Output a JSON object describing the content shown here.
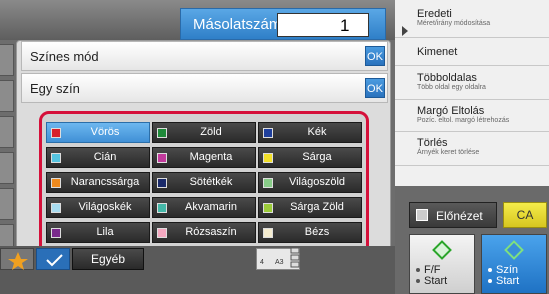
{
  "header": {
    "copies_label": "Másolatszám",
    "copies_value": "1"
  },
  "panel": {
    "rows": [
      {
        "label": "Színes mód",
        "ok": "OK"
      },
      {
        "label": "Egy szín",
        "ok": "OK"
      }
    ],
    "colors": [
      {
        "label": "Vörös",
        "swatch": "#d8202a",
        "selected": true
      },
      {
        "label": "Zöld",
        "swatch": "#1f8a3a"
      },
      {
        "label": "Kék",
        "swatch": "#1f3f9c"
      },
      {
        "label": "Cián",
        "swatch": "#55c4e0"
      },
      {
        "label": "Magenta",
        "swatch": "#c23a9c"
      },
      {
        "label": "Sárga",
        "swatch": "#f2e02a"
      },
      {
        "label": "Narancssárga",
        "swatch": "#ef8a1e"
      },
      {
        "label": "Sötétkék",
        "swatch": "#1a2a6a"
      },
      {
        "label": "Világoszöld",
        "swatch": "#88cc88"
      },
      {
        "label": "Világoskék",
        "swatch": "#a8dcf0"
      },
      {
        "label": "Akvamarin",
        "swatch": "#44b8a8"
      },
      {
        "label": "Sárga Zöld",
        "swatch": "#9ccc3a"
      },
      {
        "label": "Lila",
        "swatch": "#7a2a8c"
      },
      {
        "label": "Rózsaszín",
        "swatch": "#f4a8c0"
      },
      {
        "label": "Bézs",
        "swatch": "#f4ecd0"
      }
    ]
  },
  "sidebar": {
    "items": [
      {
        "title": "Eredeti",
        "sub": "Méret/irány módosítása"
      },
      {
        "title": "Kimenet",
        "sub": ""
      },
      {
        "title": "Többoldalas",
        "sub": "Több oldal egy oldalra"
      },
      {
        "title": "Margó Eltolás",
        "sub": "Pozíc. eltol. margó létrehozás"
      },
      {
        "title": "Törlés",
        "sub": "Árnyék keret törlése"
      }
    ]
  },
  "actions": {
    "preview": "Előnézet",
    "ca": "CA",
    "start_bw_line1": "F/F",
    "start_bw_line2": "Start",
    "start_color_line1": "Szín",
    "start_color_line2": "Start"
  },
  "bottom": {
    "other": "Egyéb",
    "paper_num": "4",
    "paper_size": "A3"
  }
}
